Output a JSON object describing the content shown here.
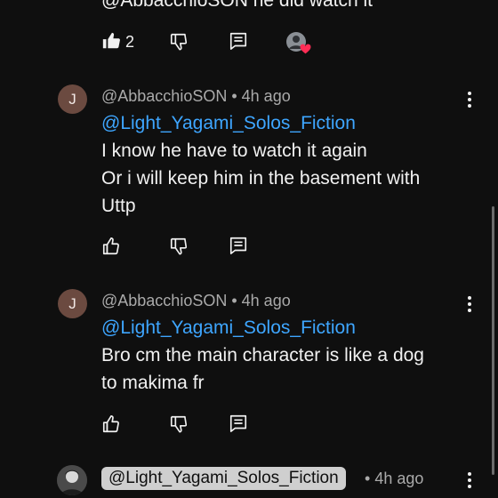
{
  "top_comment": {
    "partial_text": "@AbbacchioSON he did watch it",
    "likes": "2",
    "icons": [
      "thumbs-up-filled-icon",
      "thumbs-down-icon",
      "reply-icon",
      "creator-heart-icon"
    ]
  },
  "replies": [
    {
      "avatar_letter": "J",
      "author": "@AbbacchioSON",
      "time": "4h ago",
      "mention": "@Light_Yagami_Solos_Fiction",
      "lines": [
        "I know he have to watch it again",
        "Or i will keep him in the basement with",
        "Uttp"
      ]
    },
    {
      "avatar_letter": "J",
      "author": "@AbbacchioSON",
      "time": "4h ago",
      "mention": "@Light_Yagami_Solos_Fiction",
      "lines": [
        "Bro cm the main character is like a dog",
        "to makima fr"
      ]
    }
  ],
  "bottom_comment": {
    "author": "@Light_Yagami_Solos_Fiction",
    "time": "4h ago",
    "separator": "•"
  },
  "colors": {
    "background": "#0f0f0f",
    "mention": "#3ea6ff",
    "creator_heart": "#ff2d55"
  }
}
